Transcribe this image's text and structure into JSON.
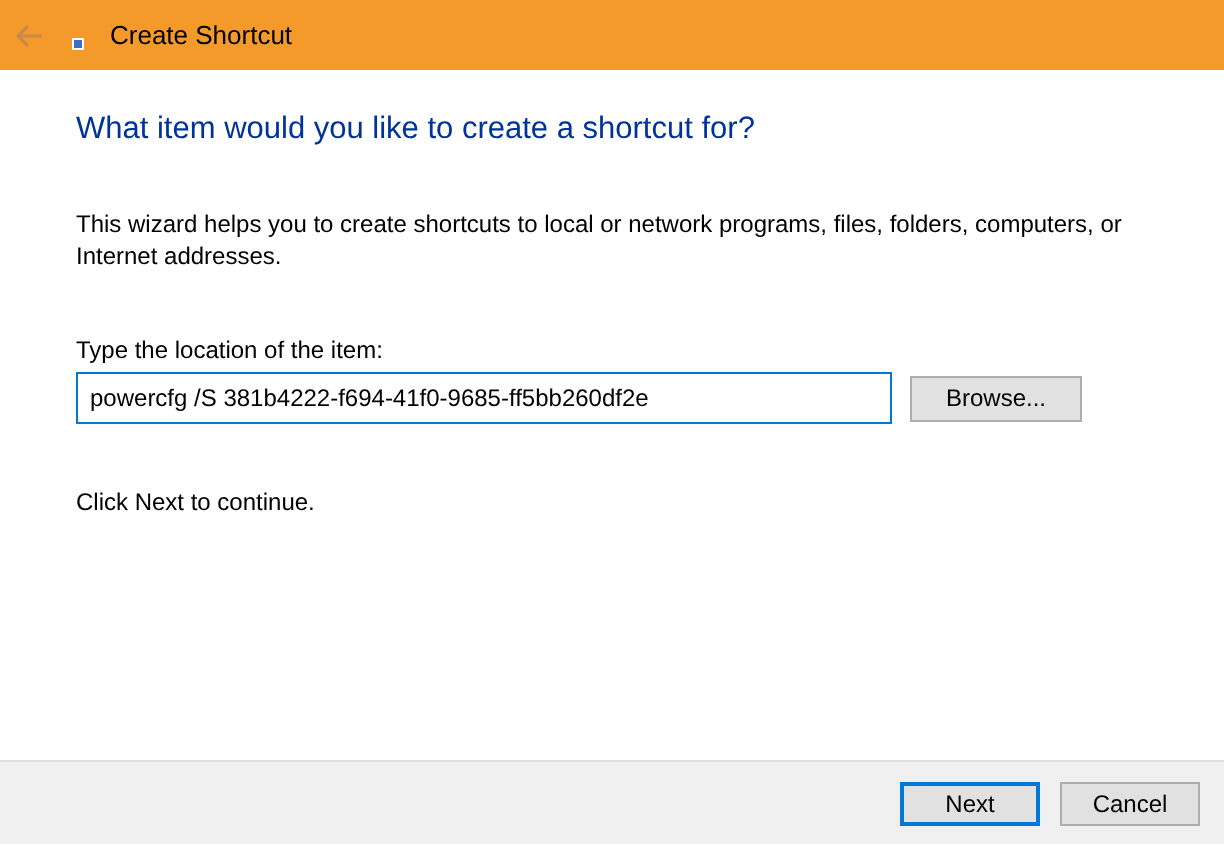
{
  "window": {
    "title": "Create Shortcut"
  },
  "heading": "What item would you like to create a shortcut for?",
  "description": "This wizard helps you to create shortcuts to local or network programs, files, folders, computers, or Internet addresses.",
  "location": {
    "label": "Type the location of the item:",
    "value": "powercfg /S 381b4222-f694-41f0-9685-ff5bb260df2e",
    "browse": "Browse..."
  },
  "hint": "Click Next to continue.",
  "buttons": [
    {
      "label": "Next",
      "default": true
    },
    {
      "label": "Cancel",
      "default": false
    }
  ]
}
